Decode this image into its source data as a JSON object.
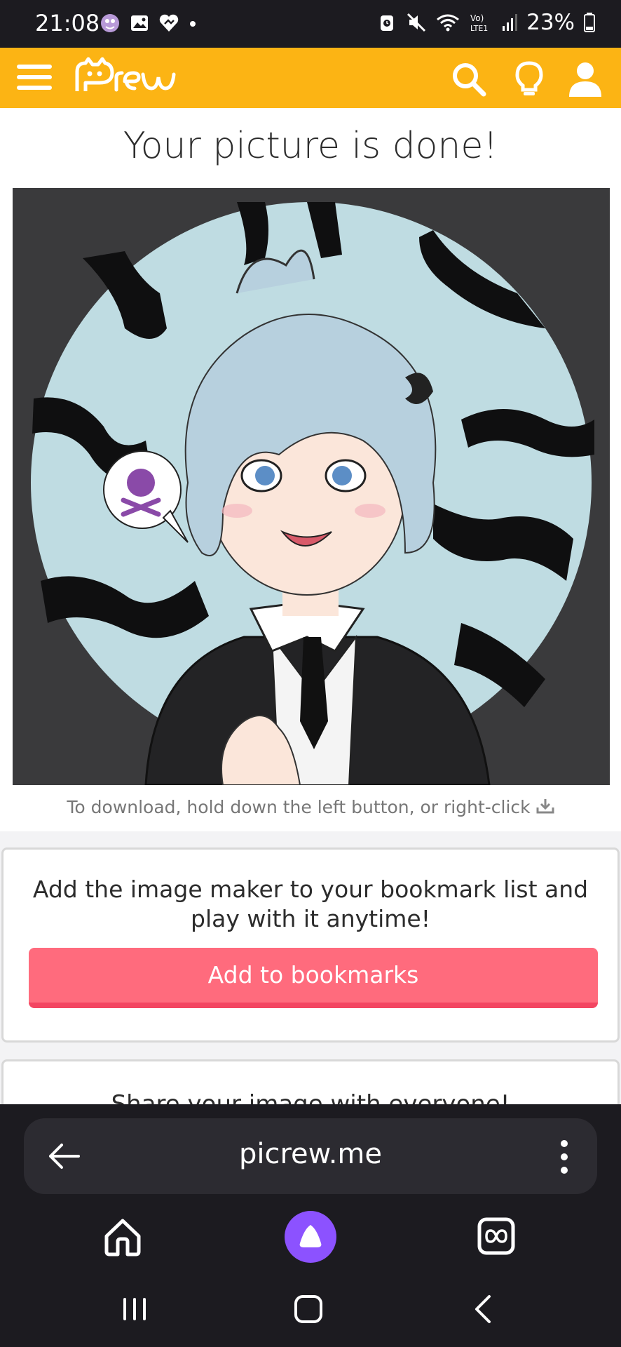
{
  "status_bar": {
    "time": "21:08",
    "battery": "23%",
    "icons": [
      "app-notification-icon",
      "gallery-icon",
      "heart-badge-icon",
      "dot-icon",
      "alarm-icon",
      "mute-icon",
      "wifi-icon",
      "volte-icon",
      "signal-icon",
      "battery-icon"
    ]
  },
  "header": {
    "logo_text": "Picrew",
    "icons": [
      "menu-icon",
      "search-icon",
      "lightbulb-icon",
      "user-icon"
    ],
    "accent": "#fcb414"
  },
  "main": {
    "title": "Your picture is done!",
    "image_alt": "Generated avatar picture",
    "download_hint": "To download, hold down the left button, or right-click"
  },
  "bookmark_card": {
    "text": "Add the image maker to your bookmark list and play with it anytime!",
    "button_label": "Add to bookmarks",
    "button_color": "#ff6b7d"
  },
  "share_card": {
    "text": "Share your image with everyone!"
  },
  "browser": {
    "url": "picrew.me",
    "icons": [
      "back-arrow-icon",
      "more-vert-icon",
      "home-icon",
      "assistant-icon",
      "tabs-icon"
    ]
  },
  "system_nav": {
    "icons": [
      "recent-apps-icon",
      "home-button-icon",
      "back-icon"
    ]
  }
}
